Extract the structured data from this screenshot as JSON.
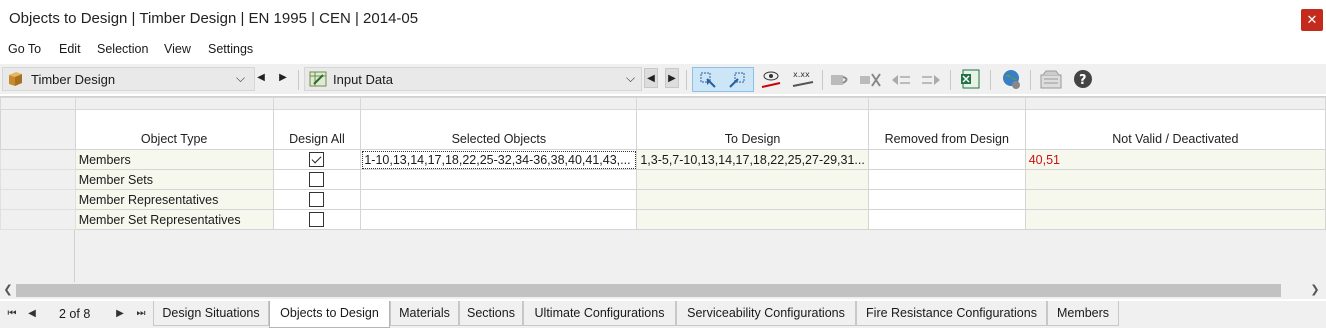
{
  "window": {
    "title": "Objects to Design | Timber Design | EN 1995 | CEN | 2014-05",
    "close_glyph": "✕"
  },
  "menu": [
    "Go To",
    "Edit",
    "Selection",
    "View",
    "Settings"
  ],
  "toolbar": {
    "module_label": "Timber Design",
    "view_label": "Input Data",
    "accent": "#cde6f7"
  },
  "table": {
    "header_top": [
      "",
      "",
      "",
      "",
      "",
      "",
      ""
    ],
    "columns": [
      "",
      "Object Type",
      "Design All",
      "Selected Objects",
      "To Design",
      "Removed from Design",
      "Not Valid / Deactivated"
    ],
    "rows": [
      {
        "type": "Members",
        "checked": true,
        "selected": "1-10,13,14,17,18,22,25-32,34-36,38,40,41,43,...",
        "to_design": "1,3-5,7-10,13,14,17,18,22,25,27-29,31...",
        "removed": "",
        "not_valid": "40,51"
      },
      {
        "type": "Member Sets",
        "checked": false,
        "selected": "",
        "to_design": "",
        "removed": "",
        "not_valid": ""
      },
      {
        "type": "Member Representatives",
        "checked": false,
        "selected": "",
        "to_design": "",
        "removed": "",
        "not_valid": ""
      },
      {
        "type": "Member Set Representatives",
        "checked": false,
        "selected": "",
        "to_design": "",
        "removed": "",
        "not_valid": ""
      }
    ],
    "not_valid_color": "#d01010"
  },
  "pager": {
    "text": "2 of 8"
  },
  "tabs": [
    {
      "label": "Design Situations",
      "active": false
    },
    {
      "label": "Objects to Design",
      "active": true
    },
    {
      "label": "Materials",
      "active": false
    },
    {
      "label": "Sections",
      "active": false
    },
    {
      "label": "Ultimate Configurations",
      "active": false
    },
    {
      "label": "Serviceability Configurations",
      "active": false
    },
    {
      "label": "Fire Resistance Configurations",
      "active": false
    },
    {
      "label": "Members",
      "active": false
    }
  ]
}
